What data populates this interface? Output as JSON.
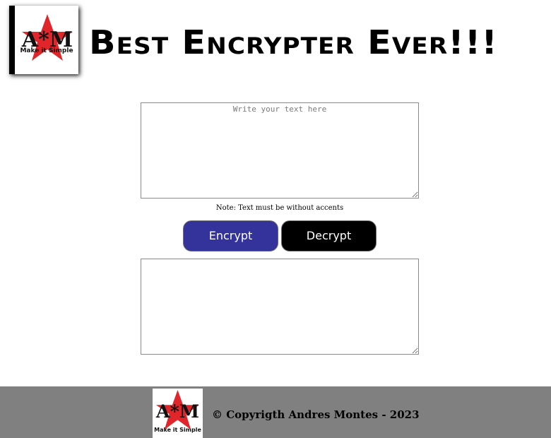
{
  "header": {
    "logo_caption": "Make it Simple",
    "title": "Best Encrypter Ever!!!"
  },
  "main": {
    "input": {
      "placeholder": "Write your text here",
      "value": ""
    },
    "note": "Note: Text must be without accents",
    "encrypt_label": "Encrypt",
    "decrypt_label": "Decrypt",
    "output": {
      "value": ""
    }
  },
  "footer": {
    "logo_caption": "Make it Simple",
    "copyright": "© Copyrigth Andres Montes - 2023"
  },
  "icons": {
    "logo": "star-am-logo-icon",
    "resize": "resize-grip-icon"
  },
  "colors": {
    "encrypt_button": "#33339b",
    "decrypt_button": "#000000",
    "footer_background": "#808080",
    "logo_star": "#e1262b"
  }
}
